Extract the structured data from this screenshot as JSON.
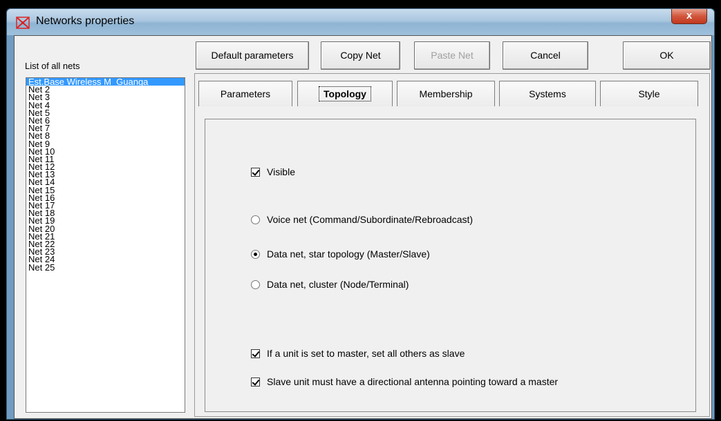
{
  "window": {
    "title": "Networks properties",
    "close_glyph": "x"
  },
  "list": {
    "label": "List of all nets",
    "items": [
      "Est.Base Wireless M_Guanga",
      "Net  2",
      "Net  3",
      "Net  4",
      "Net  5",
      "Net  6",
      "Net  7",
      "Net  8",
      "Net  9",
      "Net 10",
      "Net 11",
      "Net 12",
      "Net 13",
      "Net 14",
      "Net 15",
      "Net 16",
      "Net 17",
      "Net 18",
      "Net 19",
      "Net 20",
      "Net 21",
      "Net 22",
      "Net 23",
      "Net 24",
      "Net 25"
    ],
    "selected_index": 0
  },
  "toolbar": {
    "default_label": "Default parameters",
    "copy_label": "Copy Net",
    "paste_label": "Paste Net",
    "cancel_label": "Cancel",
    "ok_label": "OK"
  },
  "tabs": [
    {
      "label": "Parameters",
      "active": false
    },
    {
      "label": "Topology",
      "active": true
    },
    {
      "label": "Membership",
      "active": false
    },
    {
      "label": "Systems",
      "active": false
    },
    {
      "label": "Style",
      "active": false
    }
  ],
  "topology": {
    "visible_label": "Visible",
    "visible_checked": true,
    "voice_label": "Voice net (Command/Subordinate/Rebroadcast)",
    "star_label": "Data net, star topology (Master/Slave)",
    "cluster_label": "Data net, cluster (Node/Terminal)",
    "selected_topology": "star",
    "master_label": "If a unit is set to master, set all others as slave",
    "master_checked": true,
    "slave_label": "Slave unit must have a directional antenna pointing toward a master",
    "slave_checked": true
  },
  "colors": {
    "selection": "#3399ff",
    "close_button": "#c0391f",
    "window_frame": "#6f9cc0"
  }
}
